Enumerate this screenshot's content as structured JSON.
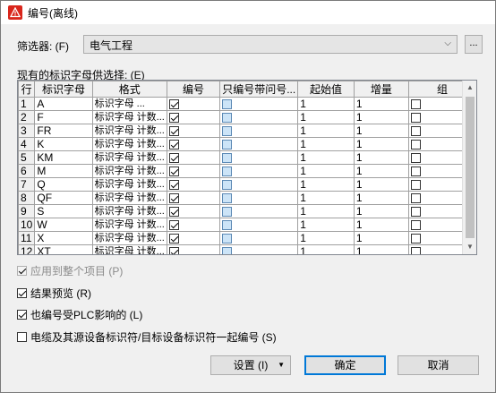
{
  "window": {
    "title": "编号(离线)"
  },
  "filter": {
    "label": "筛选器: (F)",
    "value": "电气工程",
    "browse_label": "..."
  },
  "list": {
    "label": "现有的标识字母供选择: (E)"
  },
  "table": {
    "columns": [
      "行",
      "标识字母",
      "格式",
      "编号",
      "只编号带问号...",
      "起始值",
      "增量",
      "组"
    ],
    "rows": [
      {
        "num": "1",
        "letter": "A",
        "format": "标识字母 ...",
        "numbered": true,
        "only_q": false,
        "start": "1",
        "inc": "1",
        "group": false
      },
      {
        "num": "2",
        "letter": "F",
        "format": "标识字母 计数...",
        "numbered": true,
        "only_q": false,
        "start": "1",
        "inc": "1",
        "group": false
      },
      {
        "num": "3",
        "letter": "FR",
        "format": "标识字母 计数...",
        "numbered": true,
        "only_q": false,
        "start": "1",
        "inc": "1",
        "group": false
      },
      {
        "num": "4",
        "letter": "K",
        "format": "标识字母 计数...",
        "numbered": true,
        "only_q": false,
        "start": "1",
        "inc": "1",
        "group": false
      },
      {
        "num": "5",
        "letter": "KM",
        "format": "标识字母 计数...",
        "numbered": true,
        "only_q": false,
        "start": "1",
        "inc": "1",
        "group": false
      },
      {
        "num": "6",
        "letter": "M",
        "format": "标识字母 计数...",
        "numbered": true,
        "only_q": false,
        "start": "1",
        "inc": "1",
        "group": false
      },
      {
        "num": "7",
        "letter": "Q",
        "format": "标识字母 计数...",
        "numbered": true,
        "only_q": false,
        "start": "1",
        "inc": "1",
        "group": false
      },
      {
        "num": "8",
        "letter": "QF",
        "format": "标识字母 计数...",
        "numbered": true,
        "only_q": false,
        "start": "1",
        "inc": "1",
        "group": false
      },
      {
        "num": "9",
        "letter": "S",
        "format": "标识字母 计数...",
        "numbered": true,
        "only_q": false,
        "start": "1",
        "inc": "1",
        "group": false
      },
      {
        "num": "10",
        "letter": "W",
        "format": "标识字母 计数...",
        "numbered": true,
        "only_q": false,
        "start": "1",
        "inc": "1",
        "group": false
      },
      {
        "num": "11",
        "letter": "X",
        "format": "标识字母 计数...",
        "numbered": true,
        "only_q": false,
        "start": "1",
        "inc": "1",
        "group": false
      },
      {
        "num": "12",
        "letter": "XT",
        "format": "标识字母 计数...",
        "numbered": true,
        "only_q": false,
        "start": "1",
        "inc": "1",
        "group": false
      }
    ]
  },
  "options": {
    "apply_all": {
      "label": "应用到整个项目 (P)",
      "checked": true,
      "disabled": true
    },
    "preview": {
      "label": "结果预览 (R)",
      "checked": true
    },
    "plc": {
      "label": "也编号受PLC影响的 (L)",
      "checked": true
    },
    "cable": {
      "label": "电缆及其源设备标识符/目标设备标识符一起编号 (S)",
      "checked": false
    }
  },
  "buttons": {
    "settings": "设置 (I)",
    "ok": "确定",
    "cancel": "取消"
  },
  "colors": {
    "accent": "#0078d7",
    "app_icon": "#d9261c"
  }
}
